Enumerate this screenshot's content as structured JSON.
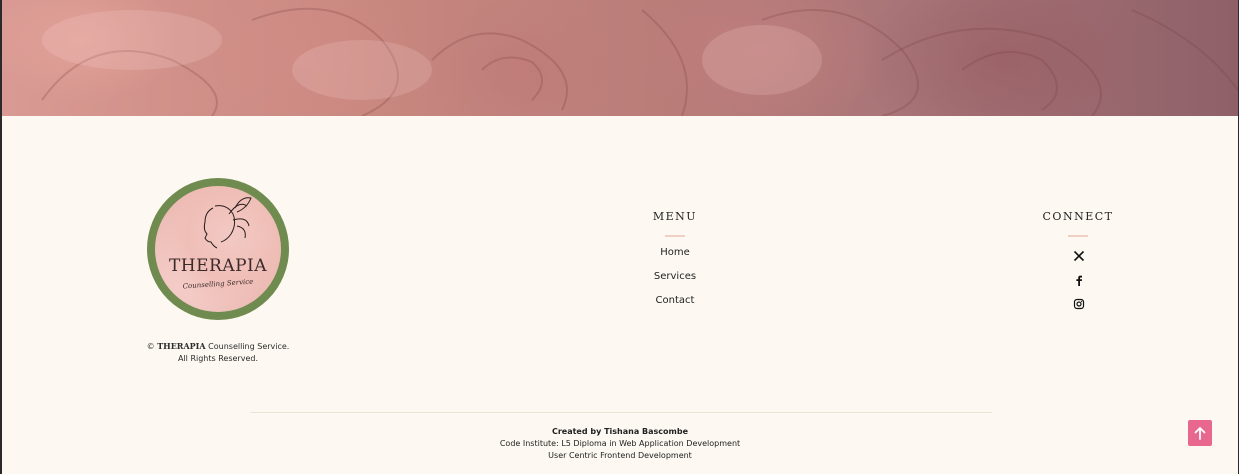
{
  "brand": {
    "logo_title": "THERAPIA",
    "logo_subtitle": "Counselling Service",
    "copyright_symbol": "©",
    "copyright_brand": "THERAPIA",
    "copyright_rest": "Counselling Service.",
    "rights": "All Rights Reserved."
  },
  "menu": {
    "heading": "MENU",
    "items": [
      "Home",
      "Services",
      "Contact"
    ]
  },
  "connect": {
    "heading": "CONNECT",
    "icons": [
      "x-twitter-icon",
      "facebook-icon",
      "instagram-icon"
    ]
  },
  "credits": {
    "created_by": "Created by Tishana Bascombe",
    "line2": "Code Institute: L5 Diploma in Web Application Development",
    "line3": "User Centric Frontend Development"
  },
  "colors": {
    "background": "#fdf9f2",
    "logo_ring": "#6f8b4f",
    "accent_underline": "#f0cfc4",
    "back_to_top": "#e8678f"
  },
  "back_to_top": {
    "icon": "arrow-up-icon"
  }
}
